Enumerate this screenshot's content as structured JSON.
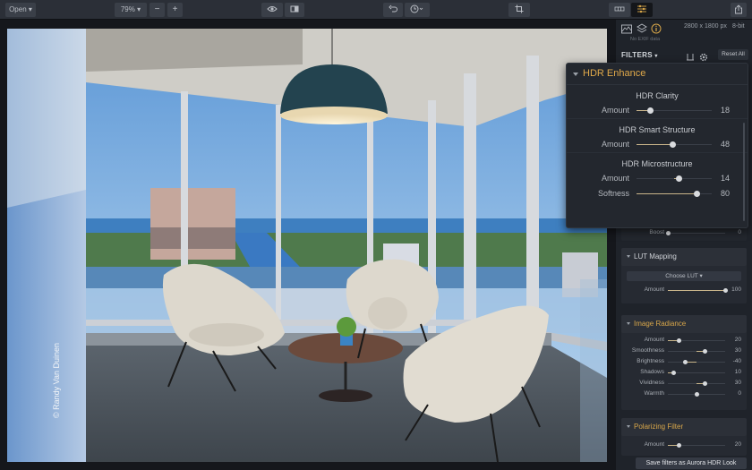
{
  "toolbar": {
    "open_label": "Open",
    "zoom_value": "79%",
    "zoom_out": "−",
    "zoom_in": "+",
    "icons": {
      "chevron": "chevron-down-icon",
      "preview": "eye-icon",
      "compare": "split-compare-icon",
      "undo": "undo-icon",
      "history": "history-icon",
      "crop": "crop-icon",
      "layout": "filmstrip-icon",
      "adjust": "sliders-icon",
      "share": "share-icon"
    }
  },
  "photo": {
    "watermark": "© Randy Van Duinen",
    "description": "Office lounge with Womb chairs overlooking river and city through floor-to-ceiling windows"
  },
  "panel": {
    "tabs": [
      "histogram",
      "layers",
      "info"
    ],
    "dimensions": "2800 x 1800 px",
    "bit_depth": "8-bit",
    "exif": "No EXIF data",
    "filters_label": "FILTERS",
    "reset_label": "Reset All",
    "boost": {
      "label": "Boost",
      "value": "0",
      "fraction": 0.0
    },
    "lut": {
      "title": "LUT Mapping",
      "choose": "Choose LUT",
      "amount": {
        "label": "Amount",
        "value": "100",
        "fraction": 1.0
      }
    },
    "radiance": {
      "title": "Image Radiance",
      "sliders": [
        {
          "label": "Amount",
          "value": "20",
          "fraction": 0.2,
          "bipolar": false
        },
        {
          "label": "Smoothness",
          "value": "30",
          "fraction": 0.65,
          "bipolar": true
        },
        {
          "label": "Brightness",
          "value": "-40",
          "fraction": 0.3,
          "bipolar": true
        },
        {
          "label": "Shadows",
          "value": "10",
          "fraction": 0.1,
          "bipolar": false
        },
        {
          "label": "Vividness",
          "value": "30",
          "fraction": 0.65,
          "bipolar": true
        },
        {
          "label": "Warmth",
          "value": "0",
          "fraction": 0.5,
          "bipolar": true
        }
      ]
    },
    "polarizing": {
      "title": "Polarizing Filter",
      "amount": {
        "label": "Amount",
        "value": "20",
        "fraction": 0.2
      }
    },
    "save_label": "Save filters as Aurora HDR Look"
  },
  "popup": {
    "title": "HDR Enhance",
    "groups": [
      {
        "title": "HDR Clarity",
        "sliders": [
          {
            "label": "Amount",
            "value": "18",
            "fraction": 0.18,
            "bipolar": false
          }
        ]
      },
      {
        "title": "HDR Smart Structure",
        "sliders": [
          {
            "label": "Amount",
            "value": "48",
            "fraction": 0.48,
            "bipolar": false
          }
        ]
      },
      {
        "title": "HDR Microstructure",
        "sliders": [
          {
            "label": "Amount",
            "value": "14",
            "fraction": 0.57,
            "bipolar": true
          },
          {
            "label": "Softness",
            "value": "80",
            "fraction": 0.8,
            "bipolar": false
          }
        ]
      }
    ]
  },
  "colors": {
    "accent": "#d9a74a",
    "slider_fill": "#c9b58a",
    "panel_bg": "#1f232a",
    "toolbar_bg": "#2b2f37"
  }
}
